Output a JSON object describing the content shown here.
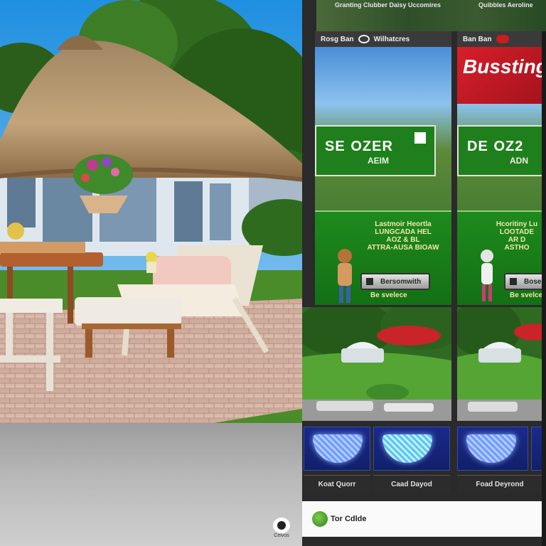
{
  "top_strip": {
    "left_text": "Granting Clubber Daisy Uccomires",
    "right_text": "Quibbles Aeroline"
  },
  "ads": [
    {
      "bar_label": "Rosg Ban",
      "bar_label_2": "Wilhatcres",
      "big_text": "SE",
      "big_text_2": "OZER",
      "small_text": "AEIM",
      "promo_text": "Lastmoir Heortla\nLUNGCADA HEL\nAOZ & BL\nATTRA-AUSA BIOAW",
      "cta_label": "Bersomwith",
      "foot_text": "Be svelece"
    },
    {
      "bar_label": "Ban Ban",
      "banner_text": "Busstinge",
      "big_text": "DE",
      "big_text_2": "OZ2",
      "small_text": "ADN",
      "promo_text": "Hcoritiny Lu\nLOOTADE\nAR D\nASTHO",
      "cta_label": "Boserdh",
      "foot_text": "Be svelce"
    }
  ],
  "captions": [
    "Koat Quorr",
    "Caad Dayod",
    "Foad Deyrond"
  ],
  "footer": {
    "label": "Tor Cdlde"
  },
  "grey_logo_text": "Ceivos",
  "colors": {
    "ad_green": "#1f7f1c",
    "ad_red": "#d61f2a",
    "tile_blue": "#1a2a8a"
  }
}
